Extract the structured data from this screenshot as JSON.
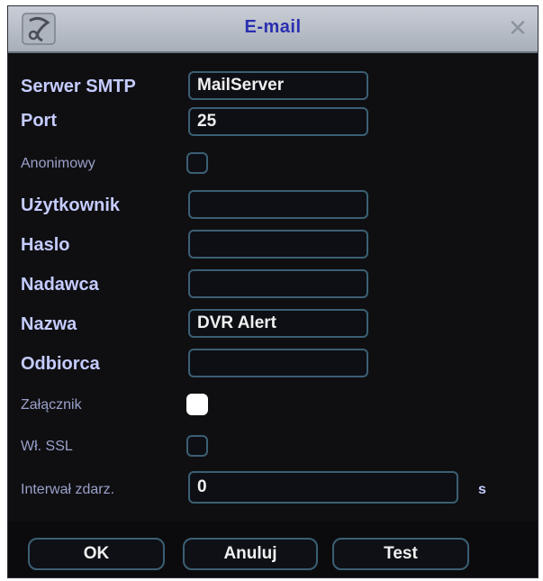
{
  "window": {
    "title": "E-mail",
    "close_glyph": "✕"
  },
  "fields": [
    {
      "label": "Serwer SMTP",
      "value": "MailServer"
    },
    {
      "label": "Port",
      "value": "25"
    },
    {
      "label": "Anonimowy",
      "checked": false
    },
    {
      "label": "Użytkownik",
      "value": ""
    },
    {
      "label": "Haslo",
      "value": ""
    },
    {
      "label": "Nadawca",
      "value": ""
    },
    {
      "label": "Nazwa",
      "value": "DVR Alert"
    },
    {
      "label": "Odbiorca",
      "value": ""
    },
    {
      "label": "Załącznik",
      "checked": true
    },
    {
      "label": "Wł. SSL",
      "checked": false
    },
    {
      "label": "Interwał zdarz.",
      "value": "0",
      "unit": "s"
    }
  ],
  "buttons": {
    "ok": "OK",
    "cancel": "Anuluj",
    "test": "Test"
  },
  "icons": {
    "title": "dvr-logo-icon",
    "close": "close-icon"
  }
}
